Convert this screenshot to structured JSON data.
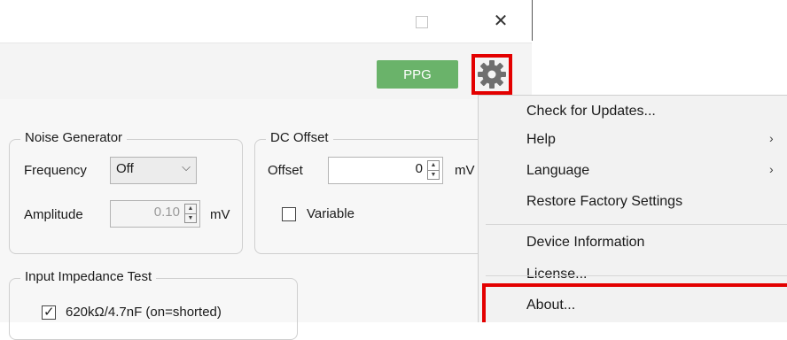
{
  "window": {
    "maximize_icon": "maximize-icon",
    "close_glyph": "✕"
  },
  "toolbar": {
    "ppg_label": "PPG",
    "settings_icon": "gear-icon",
    "highlight_color": "#e30000",
    "ppg_color": "#6ab36a"
  },
  "noise_generator": {
    "title": "Noise Generator",
    "frequency_label": "Frequency",
    "frequency_value": "Off",
    "amplitude_label": "Amplitude",
    "amplitude_value": "0.10",
    "amplitude_unit": "mV"
  },
  "dc_offset": {
    "title": "DC Offset",
    "offset_label": "Offset",
    "offset_value": "0",
    "offset_unit": "mV",
    "variable_label": "Variable",
    "variable_checked": false
  },
  "input_impedance": {
    "title": "Input Impedance Test",
    "option_label": "620kΩ/4.7nF (on=shorted)",
    "option_checked": true
  },
  "menu": {
    "items": [
      {
        "label": "Check for Updates..."
      },
      {
        "label": "Help",
        "submenu": true
      },
      {
        "label": "Language",
        "submenu": true
      },
      {
        "label": "Restore Factory Settings"
      },
      {
        "label": "Device Information"
      },
      {
        "label": "License..."
      },
      {
        "label": "About..."
      }
    ],
    "submenu_glyph": "›"
  }
}
